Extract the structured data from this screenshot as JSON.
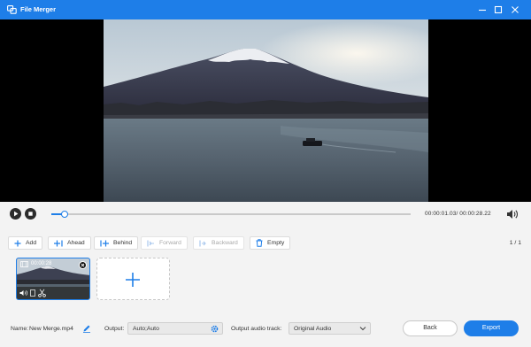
{
  "window": {
    "title": "File Merger",
    "controls": [
      "minimize",
      "maximize",
      "close"
    ]
  },
  "player": {
    "time_display": "00:00:01.03/ 00:00:28.22",
    "progress_fraction": 0.036,
    "icons": [
      "play-icon",
      "stop-icon",
      "volume-icon"
    ]
  },
  "toolbar": {
    "add_label": "Add",
    "ahead_label": "Ahead",
    "behind_label": "Behind",
    "forward_label": "Forward",
    "backward_label": "Backward",
    "empty_label": "Empty",
    "page_count": "1 / 1"
  },
  "clips": {
    "items": [
      {
        "duration": "00:00:28"
      }
    ]
  },
  "bottom": {
    "name_label": "Name:",
    "name_value": "New Merge.mp4",
    "output_label": "Output:",
    "output_value": "Auto;Auto",
    "audio_label": "Output audio track:",
    "audio_value": "Original Audio",
    "back_label": "Back",
    "export_label": "Export"
  },
  "colors": {
    "accent": "#1e7ee8",
    "panel_bg": "#f3f3f3",
    "preview_bg": "#000000"
  }
}
